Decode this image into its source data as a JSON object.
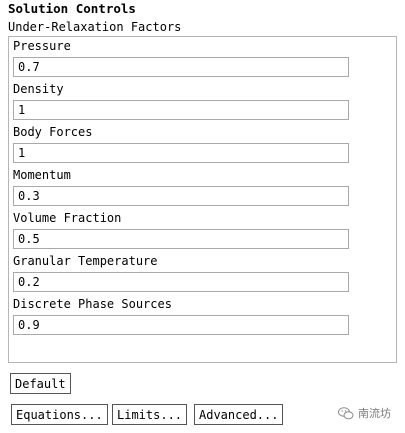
{
  "title": "Solution Controls",
  "group_label": "Under-Relaxation Factors",
  "fields": [
    {
      "label": "Pressure",
      "value": "0.7"
    },
    {
      "label": "Density",
      "value": "1"
    },
    {
      "label": "Body Forces",
      "value": "1"
    },
    {
      "label": "Momentum",
      "value": "0.3"
    },
    {
      "label": "Volume Fraction",
      "value": "0.5"
    },
    {
      "label": "Granular Temperature",
      "value": "0.2"
    },
    {
      "label": "Discrete Phase Sources",
      "value": "0.9"
    }
  ],
  "buttons": {
    "default": "Default",
    "equations": "Equations...",
    "limits": "Limits...",
    "advanced": "Advanced..."
  },
  "watermark": {
    "text": "南流坊",
    "icon": "wechat-icon"
  }
}
